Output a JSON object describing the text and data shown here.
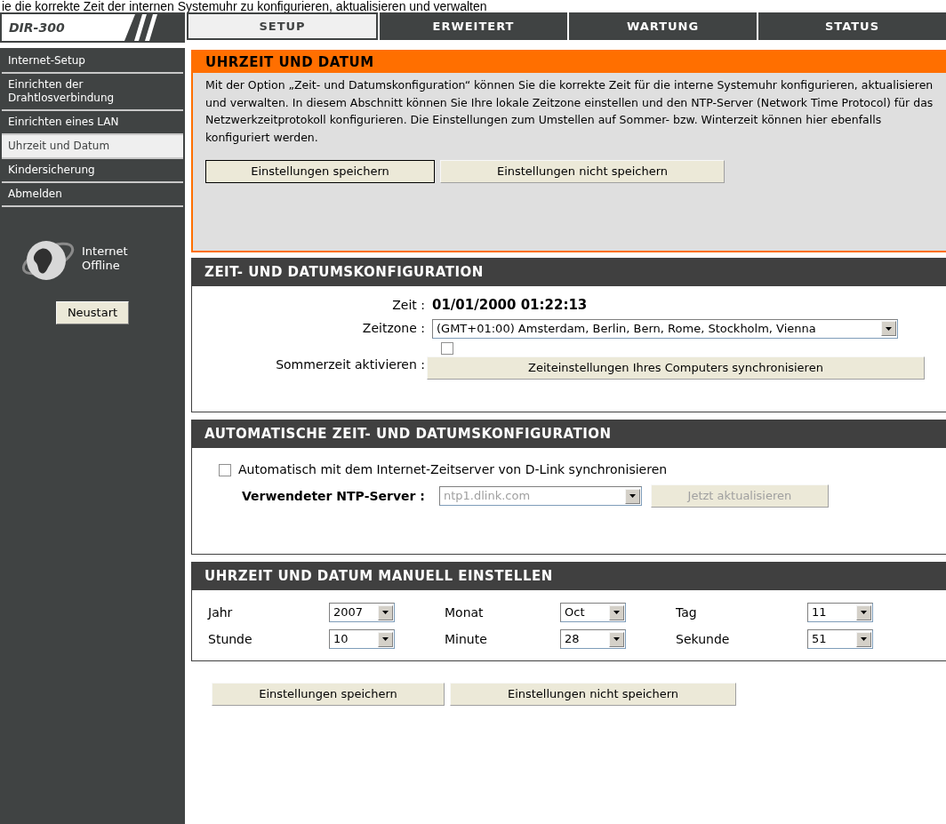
{
  "caption": "ie die korrekte Zeit der internen Systemuhr zu konfigurieren, aktualisieren und verwalten",
  "logo": "DIR-300",
  "tabs": [
    {
      "label": "SETUP",
      "selected": true
    },
    {
      "label": "ERWEITERT",
      "selected": false
    },
    {
      "label": "WARTUNG",
      "selected": false
    },
    {
      "label": "STATUS",
      "selected": false
    }
  ],
  "sidebar": {
    "items": [
      {
        "label": "Internet-Setup",
        "selected": false
      },
      {
        "label": "Einrichten der Drahtlosverbindung",
        "selected": false
      },
      {
        "label": "Einrichten eines LAN",
        "selected": false
      },
      {
        "label": "Uhrzeit und Datum",
        "selected": true
      },
      {
        "label": "Kindersicherung",
        "selected": false
      },
      {
        "label": "Abmelden",
        "selected": false
      }
    ],
    "status": [
      "Internet",
      "Offline"
    ],
    "restart_button": "Neustart"
  },
  "intro": {
    "title": "UHRZEIT UND DATUM",
    "text": "Mit der Option „Zeit- und Datumskonfiguration“ können Sie die korrekte Zeit für die interne Systemuhr konfigurieren, aktualisieren und verwalten. In diesem Abschnitt können Sie Ihre lokale Zeitzone einstellen und den NTP-Server (Network Time Protocol) für das Netzwerkzeitprotokoll konfigurieren. Die Einstellungen zum Umstellen auf Sommer- bzw. Winterzeit können hier ebenfalls konfiguriert werden.",
    "buttons": [
      "Einstellungen speichern",
      "Einstellungen nicht speichern"
    ]
  },
  "time_config": {
    "title": "ZEIT- UND DATUMSKONFIGURATION",
    "time_label": "Zeit :",
    "time_value": "01/01/2000 01:22:13",
    "timezone_label": "Zeitzone :",
    "timezone_value": "(GMT+01:00) Amsterdam, Berlin, Bern, Rome, Stockholm, Vienna",
    "dst_label": "Sommerzeit aktivieren :",
    "dst_checked": false,
    "sync_button": "Zeiteinstellungen Ihres Computers synchronisieren"
  },
  "auto_config": {
    "title": "AUTOMATISCHE ZEIT- UND DATUMSKONFIGURATION",
    "auto_label": "Automatisch mit dem Internet-Zeitserver von D-Link synchronisieren",
    "auto_checked": false,
    "ntp_label": "Verwendeter NTP-Server :",
    "ntp_value": "ntp1.dlink.com",
    "ntp_disabled": true,
    "update_button": "Jetzt aktualisieren",
    "update_disabled": true
  },
  "manual": {
    "title": "UHRZEIT UND DATUM MANUELL EINSTELLEN",
    "fields": [
      {
        "label": "Jahr",
        "value": "2007"
      },
      {
        "label": "Monat",
        "value": "Oct"
      },
      {
        "label": "Tag",
        "value": "11"
      },
      {
        "label": "Stunde",
        "value": "10"
      },
      {
        "label": "Minute",
        "value": "28"
      },
      {
        "label": "Sekunde",
        "value": "51"
      }
    ]
  },
  "bottom_buttons": [
    "Einstellungen speichern",
    "Einstellungen nicht speichern"
  ]
}
